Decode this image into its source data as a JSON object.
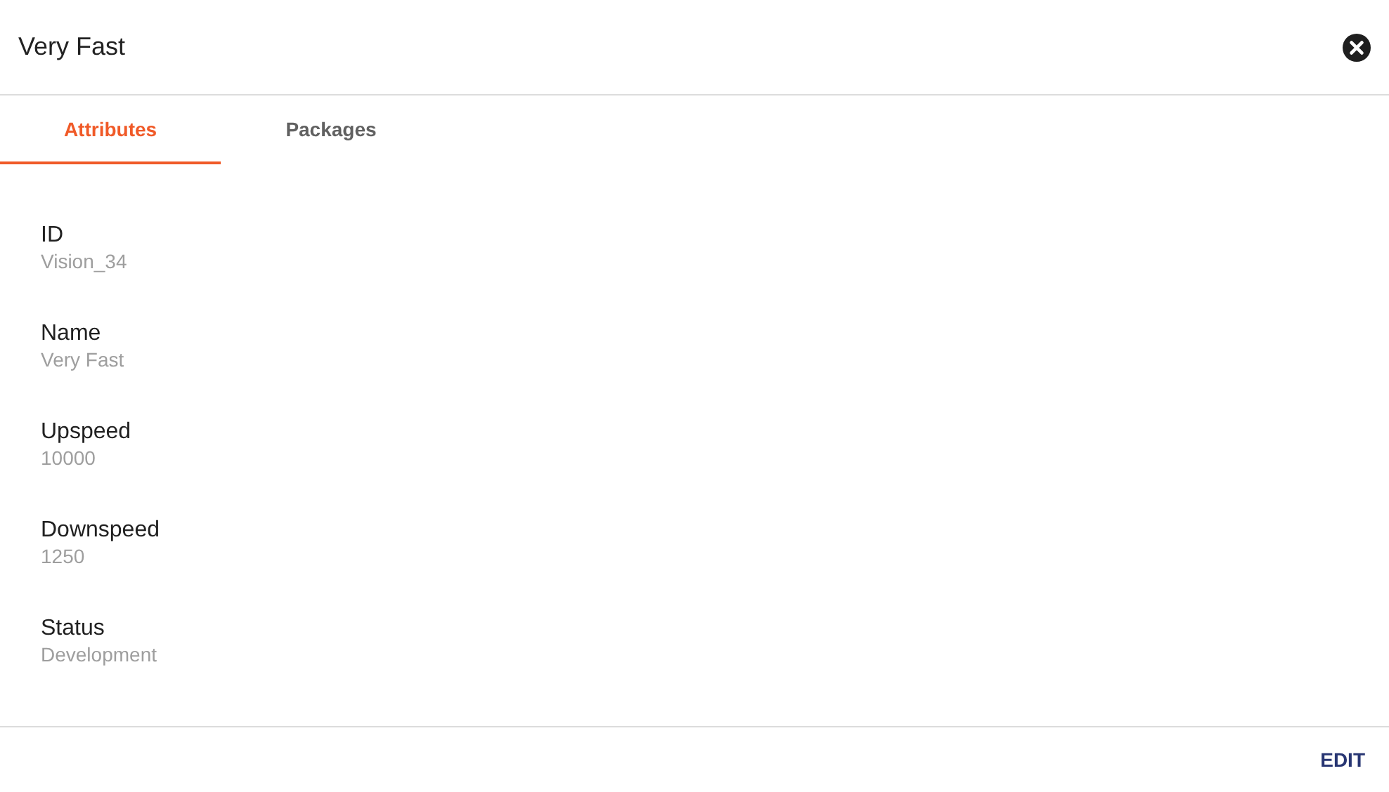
{
  "dialog": {
    "title": "Very Fast"
  },
  "tabs": [
    {
      "label": "Attributes",
      "selected": true
    },
    {
      "label": "Packages",
      "selected": false
    }
  ],
  "attributes": [
    {
      "label": "ID",
      "value": "Vision_34"
    },
    {
      "label": "Name",
      "value": "Very Fast"
    },
    {
      "label": "Upspeed",
      "value": "10000"
    },
    {
      "label": "Downspeed",
      "value": "1250"
    },
    {
      "label": "Status",
      "value": "Development"
    }
  ],
  "buttons": [
    "EDIT"
  ]
}
